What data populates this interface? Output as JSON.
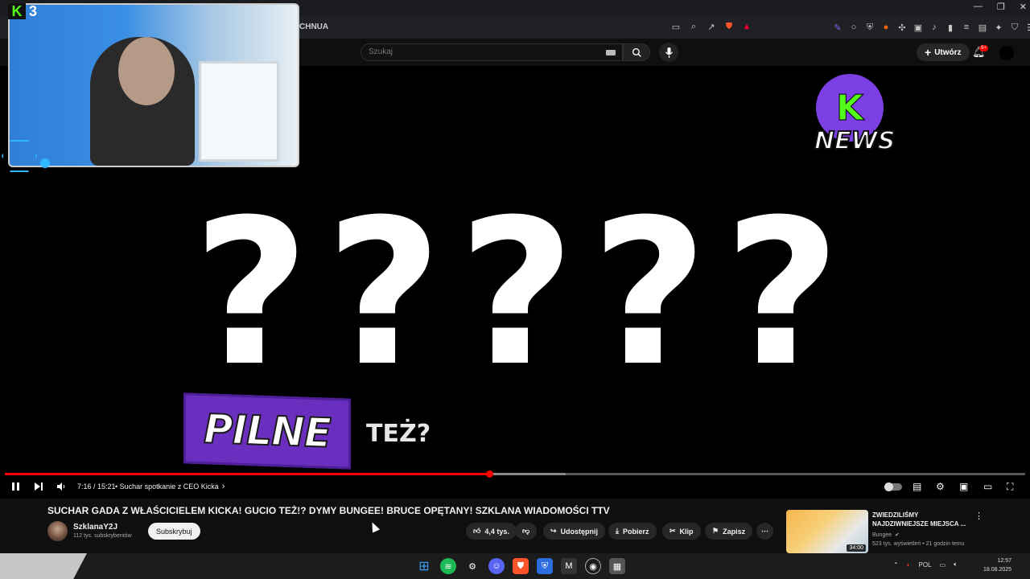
{
  "browser": {
    "tab_title": "CHNUA"
  },
  "youtube_header": {
    "search_placeholder": "Szukaj",
    "create_label": "Utwórz",
    "notification_badge": "9+"
  },
  "stream_overlay": {
    "kick_viewer_count": "3",
    "pilne_text": "PILNE",
    "tez_text": "TEŻ?",
    "question_marks": [
      "?",
      "?",
      "?",
      "?",
      "?"
    ],
    "news_logo_text": "NEWS",
    "news_logo_letter": "K"
  },
  "player": {
    "time": "7:16 / 15:21",
    "chapter": "• Suchar spotkanie z CEO Kicka",
    "chapter_chevron": "›",
    "progress_played_fraction": 0.475,
    "progress_buffered_fraction": 0.55
  },
  "video": {
    "title": "SUCHAR GADA Z WŁAŚCICIELEM KICKA! GUCIO TEŻ!? DYMY BUNGEE! BRUCE OPĘTANY! SZKLANA WIADOMOŚCI TTV",
    "channel_name": "SzklanaY2J",
    "subscribers": "112 tys. subskrybentów",
    "subscribe_label": "Subskrybuj",
    "like_count": "4,4 tys.",
    "share_label": "Udostępnij",
    "download_label": "Pobierz",
    "clip_label": "Klip",
    "save_label": "Zapisz"
  },
  "recommendation": {
    "title": "ZWIEDZILIŚMY NAJDZIWNIEJSZE MIEJSCA ...",
    "channel": "Bungee",
    "meta": "523 tys. wyświetleń • 21 godzin temu",
    "duration": "34:00"
  },
  "taskbar": {
    "language": "POL",
    "time": "12:57",
    "date": "18.08.2025"
  },
  "colors": {
    "youtube_red": "#ff0000",
    "kick_green": "#53fc18",
    "pilne_purple": "#6b2fbf",
    "background": "#0f0f0f"
  }
}
